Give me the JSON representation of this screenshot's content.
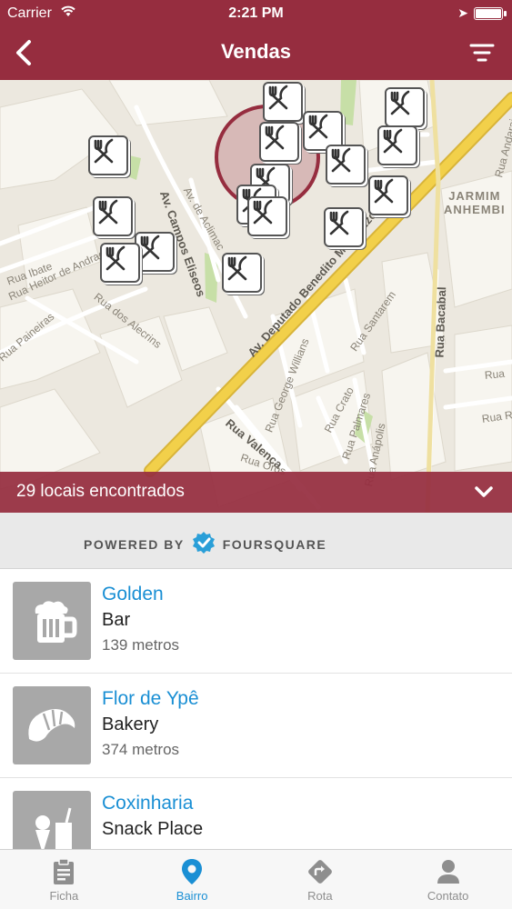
{
  "status_bar": {
    "carrier": "Carrier",
    "time": "2:21 PM"
  },
  "nav": {
    "title": "Vendas"
  },
  "map": {
    "streets": {
      "campos_eliseos": "Av. Campos Eliseos",
      "aclimacao": "Av. de Aclimac",
      "benedito": "Av. Deputado Benedito Matarazzo",
      "ibate": "Rua Ibate",
      "heitor": "Rua Heitor de Andrade",
      "paineiras": "Rua Paineiras",
      "alecrins": "Rua dos Alecrins",
      "george": "Rua George Willians",
      "santarem": "Rua Santarem",
      "bacabal": "Rua Bacabal",
      "valenca": "Rua Valença",
      "crato": "Rua Crato",
      "palmares": "Rua Palmares",
      "anapolis": "Rua Anápolis",
      "oros": "Rua Oros",
      "andarai": "Rua Andarai",
      "rua1": "Rua",
      "rua2": "Rua R"
    },
    "district": "JARMIM\nANHEMBI"
  },
  "results": {
    "count_label": "29 locais encontrados"
  },
  "powered": {
    "prefix": "POWERED BY",
    "brand": "FOURSQUARE"
  },
  "places": [
    {
      "name": "Golden",
      "category": "Bar",
      "distance": "139 metros",
      "icon": "beer-mug-icon"
    },
    {
      "name": "Flor de Ypê",
      "category": "Bakery",
      "distance": "374 metros",
      "icon": "croissant-icon"
    },
    {
      "name": "Coxinharia",
      "category": "Snack Place",
      "distance": "",
      "icon": "snack-icon"
    }
  ],
  "tabs": [
    {
      "label": "Ficha",
      "icon": "clipboard-icon",
      "active": false
    },
    {
      "label": "Bairro",
      "icon": "map-pin-icon",
      "active": true
    },
    {
      "label": "Rota",
      "icon": "route-sign-icon",
      "active": false
    },
    {
      "label": "Contato",
      "icon": "person-icon",
      "active": false
    }
  ],
  "colors": {
    "brand": "#962d3f",
    "link": "#1a8fd4",
    "major_road": "#f2d04a",
    "park": "#c7dfa7"
  }
}
